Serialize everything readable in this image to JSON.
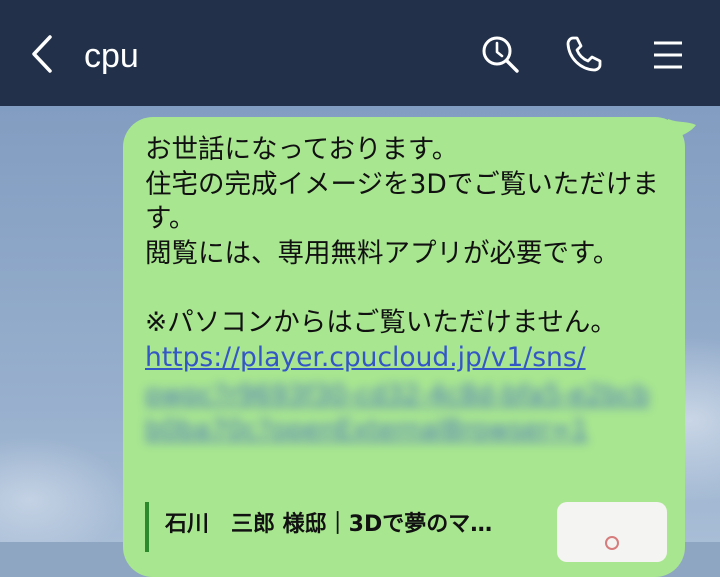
{
  "header": {
    "title": "cpu",
    "icons": [
      "chevron-left-icon",
      "search-icon",
      "phone-icon",
      "menu-icon"
    ]
  },
  "message": {
    "text": "お世話になっております。\n住宅の完成イメージを3Dでご覧いただけます。\n閲覧には、専用無料アプリが必要です。\n\n※パソコンからはご覧いただけません。",
    "link_visible": "https://player.cpucloud.jp/v1/sns/",
    "link_obscured": "pwpc?r9693f30-cd32-4c8d-bfa5-e2bcbb0ba70c?openExternalBrowser=1"
  },
  "preview": {
    "title": "石川　三郎 様邸｜3Dで夢のマ…"
  },
  "colors": {
    "header_bg": "#223049",
    "bubble_bg": "#a8e690",
    "link": "#3457c6"
  }
}
